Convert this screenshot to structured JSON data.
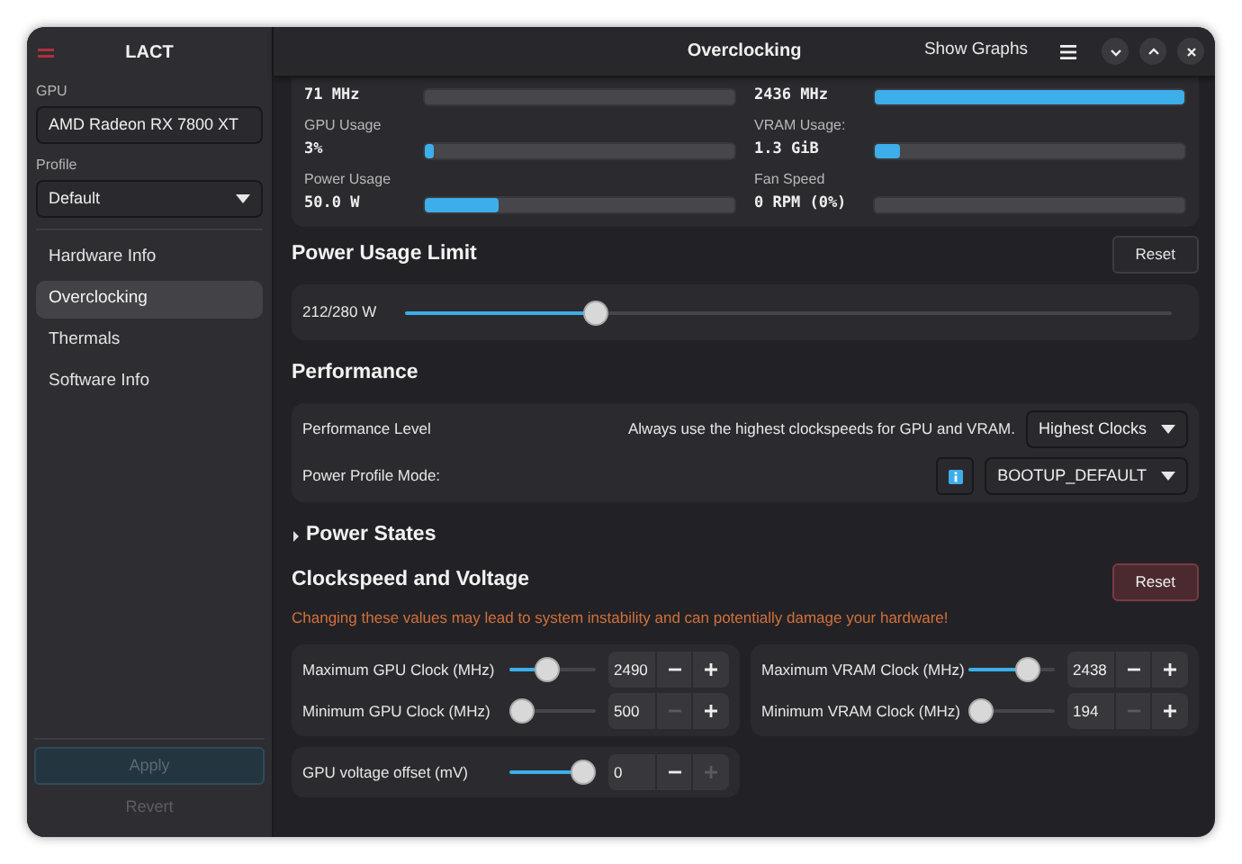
{
  "sidebar": {
    "app_title": "LACT",
    "gpu": {
      "label": "GPU",
      "value": "AMD Radeon RX 7800 XT"
    },
    "profile": {
      "label": "Profile",
      "value": "Default"
    },
    "items": [
      {
        "label": "Hardware Info",
        "selected": false
      },
      {
        "label": "Overclocking",
        "selected": true
      },
      {
        "label": "Thermals",
        "selected": false
      },
      {
        "label": "Software Info",
        "selected": false
      }
    ],
    "apply": {
      "label": "Apply",
      "disabled": true
    },
    "revert": {
      "label": "Revert",
      "disabled": true
    }
  },
  "header": {
    "title": "Overclocking",
    "show_graphs": "Show Graphs"
  },
  "stats": [
    {
      "value": "71 MHz",
      "level": 0
    },
    {
      "value": "2436 MHz",
      "level": 1
    },
    {
      "label": "GPU Usage",
      "value": "3%",
      "level": 0.03
    },
    {
      "label": "VRAM Usage:",
      "value": "1.3 GiB",
      "level": 0.08
    },
    {
      "label": "Power Usage",
      "value": "50.0 W",
      "level": 0.24
    },
    {
      "label": "Fan Speed",
      "value": "0 RPM (0%)",
      "level": 0
    }
  ],
  "power_limit": {
    "title": "Power Usage Limit",
    "reset": "Reset",
    "reading": "212/280 W",
    "level": 0.24
  },
  "performance": {
    "title": "Performance",
    "level_label": "Performance Level",
    "level_description": "Always use the highest clockspeeds for GPU and VRAM.",
    "level_value": "Highest Clocks",
    "profile_label": "Power Profile Mode:",
    "profile_value": "BOOTUP_DEFAULT"
  },
  "power_states": {
    "title": "Power States",
    "expanded": false
  },
  "clockspeed": {
    "title": "Clockspeed and Voltage",
    "reset": "Reset",
    "warning": "Changing these values may lead to system instability and can potentially damage your hardware!",
    "groups": [
      [
        {
          "label": "Maximum GPU Clock (MHz)",
          "level": 0.4,
          "value": "2490",
          "minus_disabled": false,
          "plus_disabled": false
        },
        {
          "label": "Minimum GPU Clock (MHz)",
          "level": 0,
          "value": "500",
          "minus_disabled": true,
          "plus_disabled": false
        }
      ],
      [
        {
          "label": "Maximum VRAM Clock (MHz)",
          "level": 0.75,
          "value": "2438",
          "minus_disabled": false,
          "plus_disabled": false
        },
        {
          "label": "Minimum VRAM Clock (MHz)",
          "level": 0,
          "value": "194",
          "minus_disabled": true,
          "plus_disabled": false
        }
      ],
      [
        {
          "label": "GPU voltage offset (mV)",
          "level": 1,
          "value": "0",
          "minus_disabled": false,
          "plus_disabled": true
        }
      ]
    ]
  }
}
